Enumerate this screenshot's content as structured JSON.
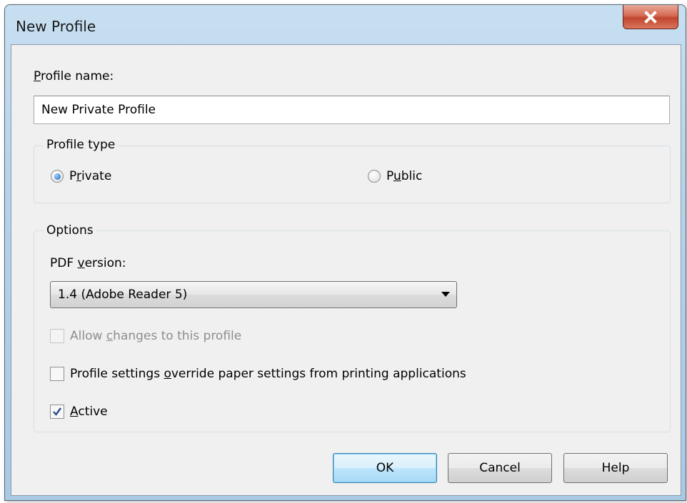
{
  "window": {
    "title": "New Profile",
    "close_icon": "close-icon",
    "colors": {
      "title_bar": "#b6d3ea",
      "close_button": "#c0462c",
      "client_bg": "#f0f0f0"
    }
  },
  "profile_name": {
    "label_before": "",
    "label_accel": "P",
    "label_after": "rofile name:",
    "value": "New Private Profile"
  },
  "profile_type": {
    "legend": "Profile type",
    "options": [
      {
        "before": "P",
        "accel": "r",
        "after": "ivate",
        "selected": true
      },
      {
        "before": "P",
        "accel": "u",
        "after": "blic",
        "selected": false
      }
    ]
  },
  "options": {
    "legend": "Options",
    "pdf_version": {
      "label_before": "PDF ",
      "label_accel": "v",
      "label_after": "ersion:",
      "selected": "1.4 (Adobe Reader 5)"
    },
    "checkboxes": [
      {
        "before": "Allow ",
        "accel": "c",
        "after": "hanges to this profile",
        "checked": false,
        "enabled": false
      },
      {
        "before": "Profile settings ",
        "accel": "o",
        "after": "verride paper settings from printing applications",
        "checked": false,
        "enabled": true
      },
      {
        "before": "",
        "accel": "A",
        "after": "ctive",
        "checked": true,
        "enabled": true
      }
    ]
  },
  "buttons": {
    "ok": "OK",
    "cancel": "Cancel",
    "help": "Help"
  }
}
